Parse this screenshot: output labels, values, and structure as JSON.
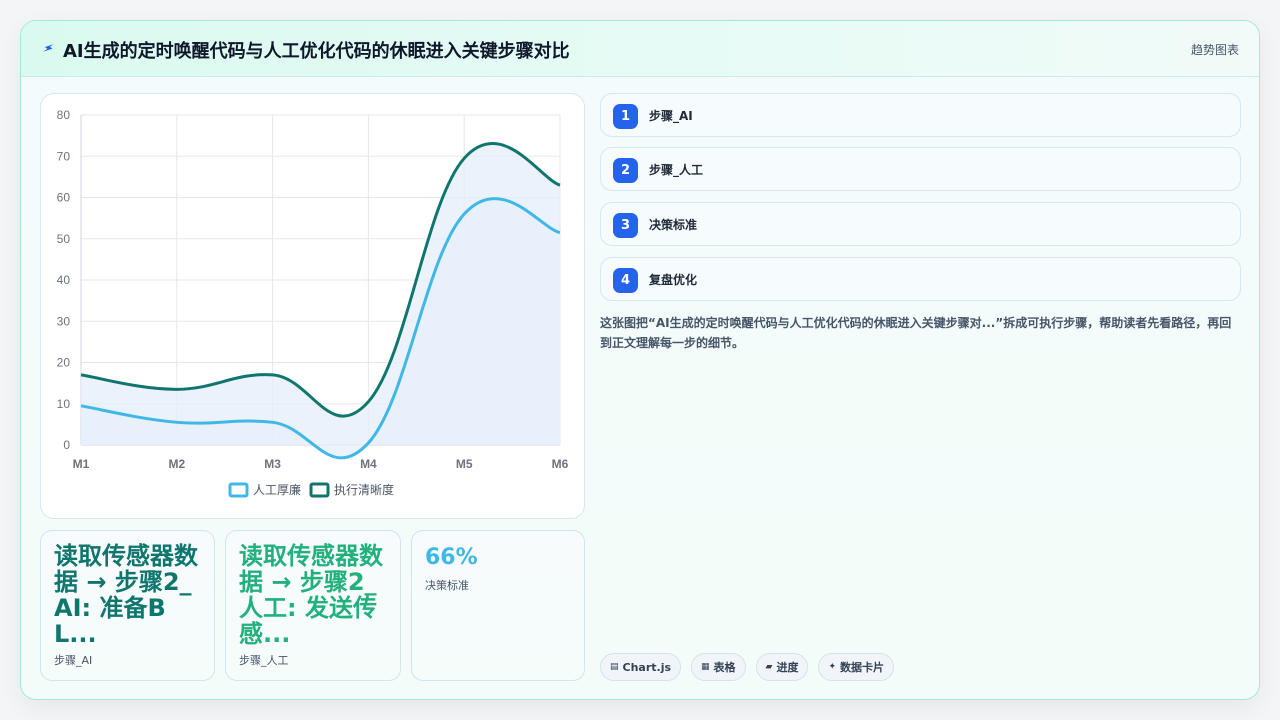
{
  "header": {
    "title": "AI生成的定时唤醒代码与人工优化代码的休眠进入关键步骤对比",
    "right_label": "趋势图表",
    "icon": "lightning-icon"
  },
  "chart_data": {
    "type": "line",
    "categories": [
      "M1",
      "M2",
      "M3",
      "M4",
      "M5",
      "M6"
    ],
    "y_ticks": [
      "0",
      "10",
      "20",
      "30",
      "40",
      "50",
      "60",
      "70",
      "80"
    ],
    "ylim": [
      0,
      80
    ],
    "grid": true,
    "legend_position": "bottom",
    "series": [
      {
        "name": "人工厚廉",
        "values": [
          9.5,
          5.5,
          5.5,
          0.5,
          56,
          51.5
        ],
        "color": "#3fb8e8",
        "fill": "#e7effb"
      },
      {
        "name": "执行清晰度",
        "values": [
          17,
          13.5,
          17,
          10.5,
          69.5,
          63
        ],
        "color": "#0f766e",
        "fill": "#e6eefb"
      }
    ]
  },
  "stats": [
    {
      "value": "读取传感器数据 → 步骤2_AI: 准备BL...",
      "label": "步骤_AI",
      "color": "#0f766e"
    },
    {
      "value": "读取传感器数据 → 步骤2_人工: 发送传感...",
      "label": "步骤_人工",
      "color": "#22b07d"
    },
    {
      "value": "66%",
      "label": "决策标准",
      "color": "#3fb8e8"
    }
  ],
  "steps": [
    {
      "num": "1",
      "label": "步骤_AI"
    },
    {
      "num": "2",
      "label": "步骤_人工"
    },
    {
      "num": "3",
      "label": "决策标准"
    },
    {
      "num": "4",
      "label": "复盘优化"
    }
  ],
  "description": "这张图把“AI生成的定时唤醒代码与人工优化代码的休眠进入关键步骤对...”拆成可执行步骤，帮助读者先看路径，再回到正文理解每一步的细节。",
  "pills": [
    {
      "icon": "▤",
      "label": "Chart.js"
    },
    {
      "icon": "▦",
      "label": "表格"
    },
    {
      "icon": "▰",
      "label": "进度"
    },
    {
      "icon": "✦",
      "label": "数据卡片"
    }
  ]
}
